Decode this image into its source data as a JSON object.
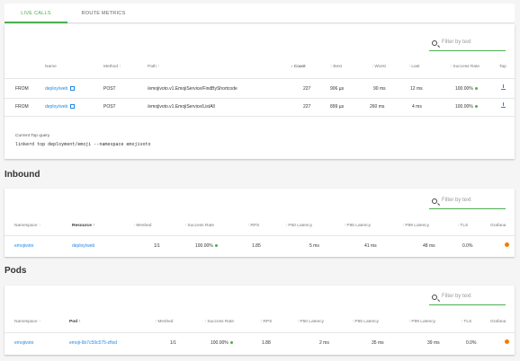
{
  "tabs": [
    {
      "label": "LIVE CALLS"
    },
    {
      "label": "ROUTE METRICS"
    }
  ],
  "colors": {
    "accent": "#4caf50",
    "link": "#1e88e5",
    "grafana": "#f57c00"
  },
  "live": {
    "search_placeholder": "Filter by text",
    "headers": {
      "name": "Name",
      "method": "Method",
      "path": "Path",
      "count": "Count",
      "best": "Best",
      "worst": "Worst",
      "last": "Last",
      "success": "Success Rate",
      "tap": "Tap"
    },
    "rows": [
      {
        "dir": "FROM",
        "name": "deploy/web",
        "method": "POST",
        "path": "/emojivoto.v1.EmojiService/FindByShortcode",
        "count": "227",
        "best": "906 µs",
        "worst": "90 ms",
        "last": "12 ms",
        "success": "100.00%"
      },
      {
        "dir": "FROM",
        "name": "deploy/web",
        "method": "POST",
        "path": "/emojivoto.v1.EmojiService/ListAll",
        "count": "227",
        "best": "899 µs",
        "worst": "260 ms",
        "last": "4 ms",
        "success": "100.00%"
      }
    ],
    "query_label": "Current Top query",
    "query": "linkerd top deployment/emoji --namespace emojivoto"
  },
  "inbound": {
    "title": "Inbound",
    "search_placeholder": "Filter by text",
    "headers": {
      "namespace": "Namespace",
      "resource": "Resource",
      "meshed": "Meshed",
      "success": "Success Rate",
      "rps": "RPS",
      "p50": "P50 Latency",
      "p95": "P95 Latency",
      "p99": "P99 Latency",
      "tls": "TLS",
      "grafana": "Grafana"
    },
    "row": {
      "namespace": "emojivoto",
      "resource": "deploy/web",
      "meshed": "1/1",
      "success": "100.00%",
      "rps": "1.85",
      "p50": "5 ms",
      "p95": "41 ms",
      "p99": "48 ms",
      "tls": "0.0%"
    }
  },
  "pods": {
    "title": "Pods",
    "search_placeholder": "Filter by text",
    "headers": {
      "namespace": "Namespace",
      "pod": "Pod",
      "meshed": "Meshed",
      "success": "Success Rate",
      "rps": "RPS",
      "p50": "P50 Latency",
      "p95": "P95 Latency",
      "p99": "P99 Latency",
      "tls": "TLS",
      "grafana": "Grafana"
    },
    "row": {
      "namespace": "emojivoto",
      "pod": "emoji-6b7c59c575-zftxd",
      "meshed": "1/1",
      "success": "100.00%",
      "rps": "1.88",
      "p50": "2 ms",
      "p95": "35 ms",
      "p99": "39 ms",
      "tls": "0.0%"
    }
  }
}
